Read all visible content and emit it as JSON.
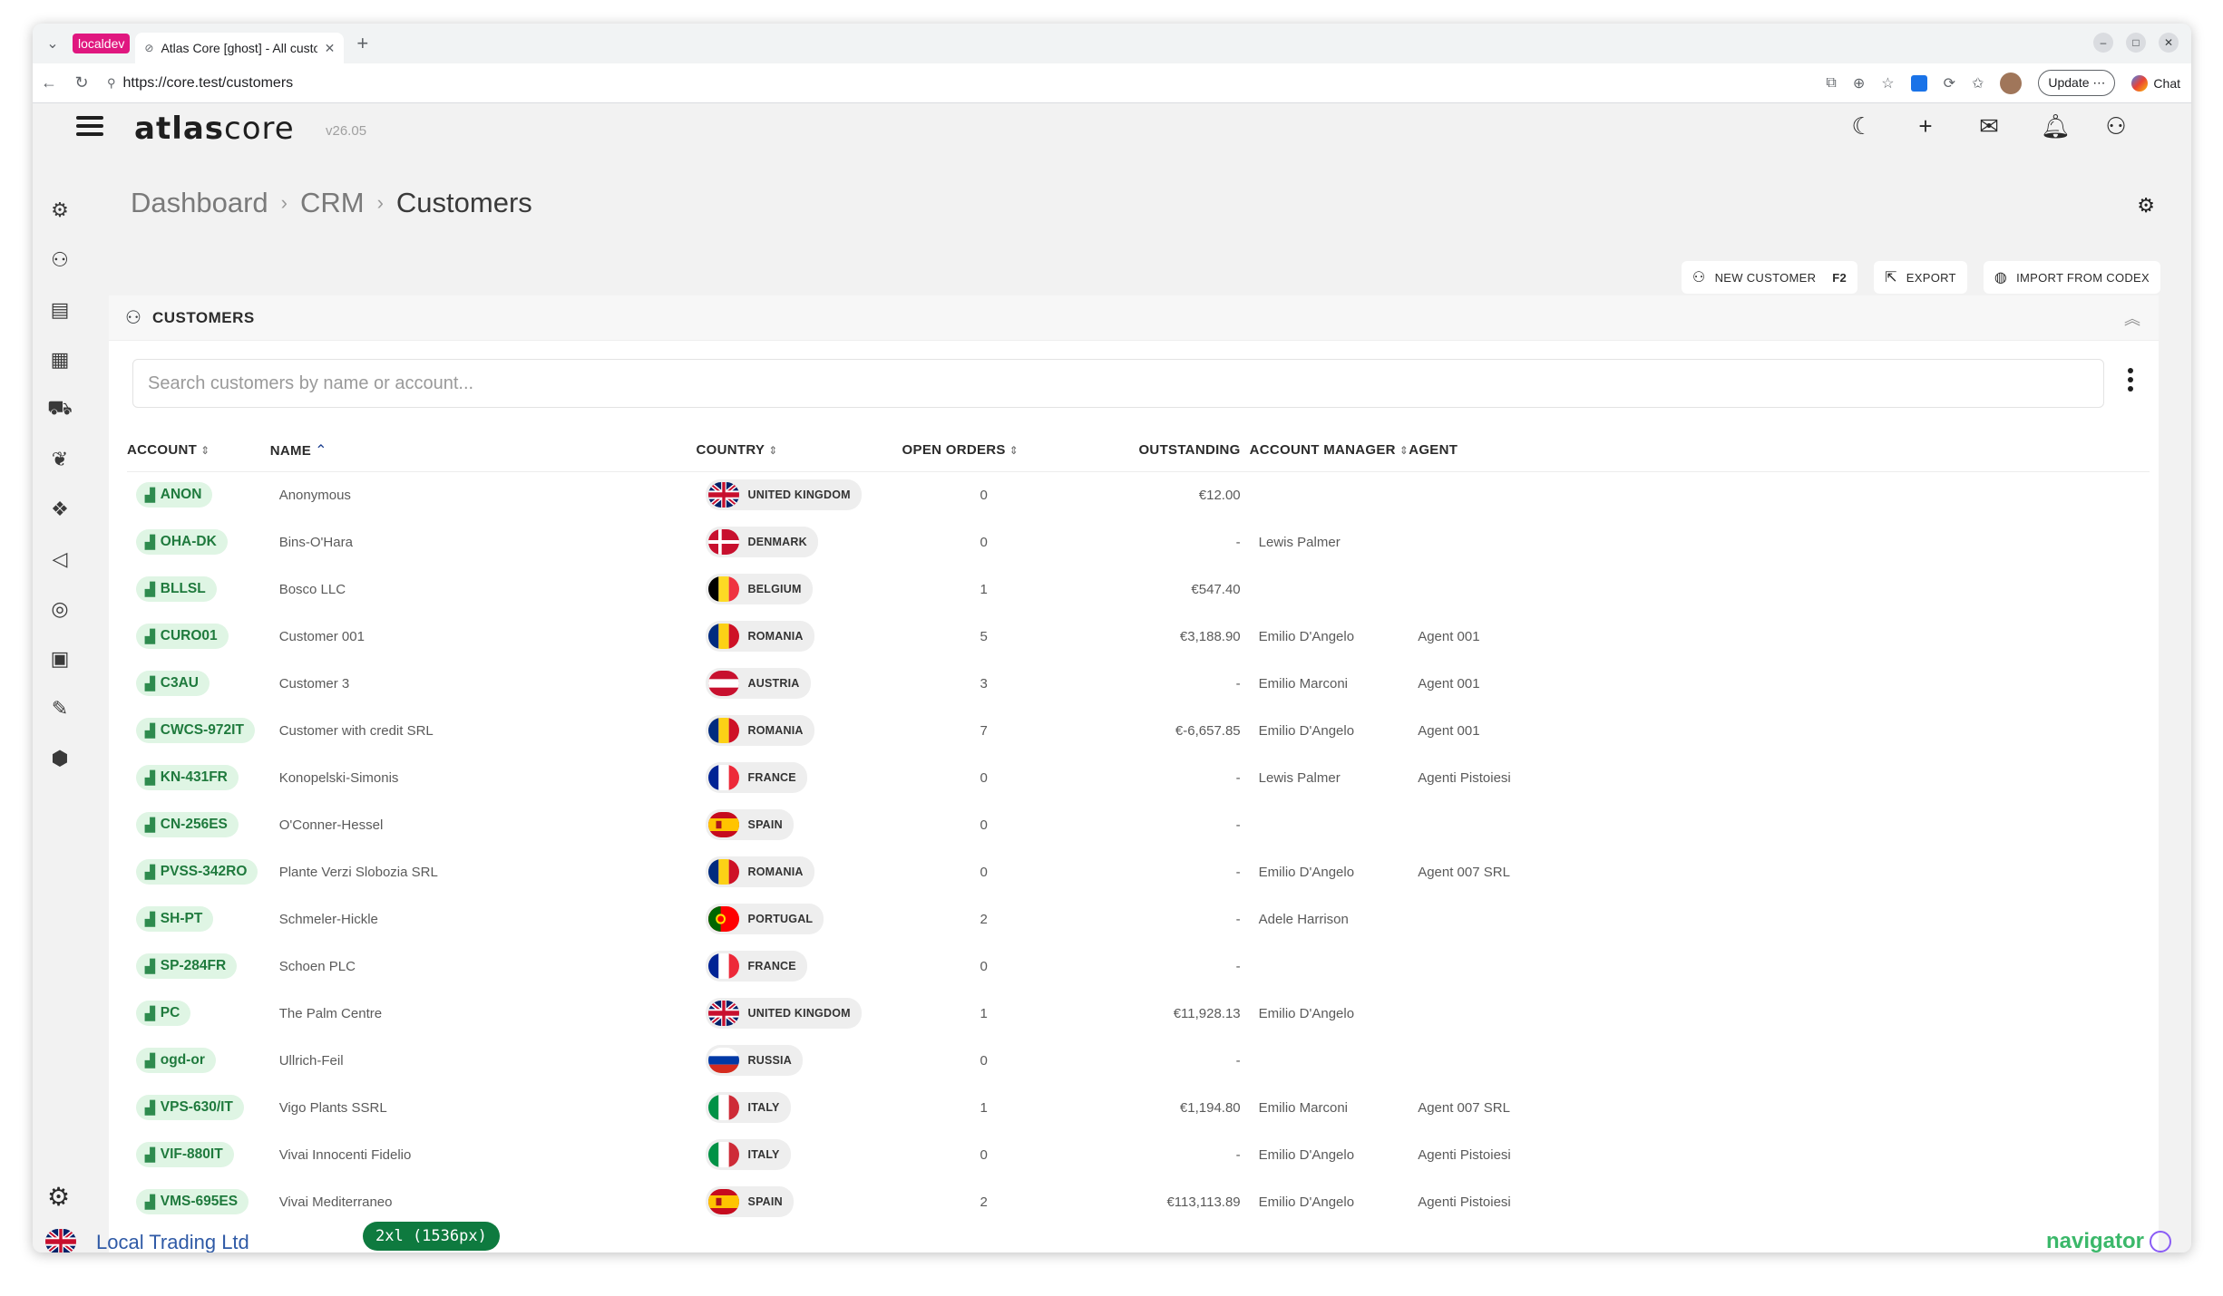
{
  "browser": {
    "profile_badge": "localdev",
    "tab_title": "Atlas Core [ghost] - All customers",
    "url": "https://core.test/customers",
    "update_label": "Update",
    "chat_label": "Chat"
  },
  "app": {
    "logo_bold": "atlas",
    "logo_light": "core",
    "version": "v26.05"
  },
  "breadcrumb": [
    "Dashboard",
    "CRM",
    "Customers"
  ],
  "actions": {
    "new_customer": "NEW CUSTOMER",
    "new_customer_key": "F2",
    "export": "EXPORT",
    "import": "IMPORT FROM CODEX"
  },
  "panel": {
    "title": "CUSTOMERS",
    "search_placeholder": "Search customers by name or account..."
  },
  "columns": [
    "ACCOUNT",
    "NAME",
    "COUNTRY",
    "OPEN ORDERS",
    "OUTSTANDING",
    "ACCOUNT MANAGER",
    "AGENT"
  ],
  "rows": [
    {
      "account": "ANON",
      "name": "Anonymous",
      "country": "UNITED KINGDOM",
      "flag": "uk",
      "orders": "0",
      "outstanding": "€12.00",
      "manager": "",
      "agent": ""
    },
    {
      "account": "OHA-DK",
      "name": "Bins-O'Hara",
      "country": "DENMARK",
      "flag": "dk",
      "orders": "0",
      "outstanding": "-",
      "manager": "Lewis Palmer",
      "agent": ""
    },
    {
      "account": "BLLSL",
      "name": "Bosco LLC",
      "country": "BELGIUM",
      "flag": "be",
      "orders": "1",
      "outstanding": "€547.40",
      "manager": "",
      "agent": ""
    },
    {
      "account": "CURO01",
      "name": "Customer 001",
      "country": "ROMANIA",
      "flag": "ro",
      "orders": "5",
      "outstanding": "€3,188.90",
      "manager": "Emilio D'Angelo",
      "agent": "Agent 001"
    },
    {
      "account": "C3AU",
      "name": "Customer 3",
      "country": "AUSTRIA",
      "flag": "at",
      "orders": "3",
      "outstanding": "-",
      "manager": "Emilio Marconi",
      "agent": "Agent 001"
    },
    {
      "account": "CWCS-972IT",
      "name": "Customer with credit SRL",
      "country": "ROMANIA",
      "flag": "ro",
      "orders": "7",
      "outstanding": "€-6,657.85",
      "manager": "Emilio D'Angelo",
      "agent": "Agent 001"
    },
    {
      "account": "KN-431FR",
      "name": "Konopelski-Simonis",
      "country": "FRANCE",
      "flag": "fr",
      "orders": "0",
      "outstanding": "-",
      "manager": "Lewis Palmer",
      "agent": "Agenti Pistoiesi"
    },
    {
      "account": "CN-256ES",
      "name": "O'Conner-Hessel",
      "country": "SPAIN",
      "flag": "es",
      "orders": "0",
      "outstanding": "-",
      "manager": "",
      "agent": ""
    },
    {
      "account": "PVSS-342RO",
      "name": "Plante Verzi Slobozia SRL",
      "country": "ROMANIA",
      "flag": "ro",
      "orders": "0",
      "outstanding": "-",
      "manager": "Emilio D'Angelo",
      "agent": "Agent 007 SRL"
    },
    {
      "account": "SH-PT",
      "name": "Schmeler-Hickle",
      "country": "PORTUGAL",
      "flag": "pt",
      "orders": "2",
      "outstanding": "-",
      "manager": "Adele Harrison",
      "agent": ""
    },
    {
      "account": "SP-284FR",
      "name": "Schoen PLC",
      "country": "FRANCE",
      "flag": "fr",
      "orders": "0",
      "outstanding": "-",
      "manager": "",
      "agent": ""
    },
    {
      "account": "PC",
      "name": "The Palm Centre",
      "country": "UNITED KINGDOM",
      "flag": "uk",
      "orders": "1",
      "outstanding": "€11,928.13",
      "manager": "Emilio D'Angelo",
      "agent": ""
    },
    {
      "account": "ogd-or",
      "name": "Ullrich-Feil",
      "country": "RUSSIA",
      "flag": "ru",
      "orders": "0",
      "outstanding": "-",
      "manager": "",
      "agent": ""
    },
    {
      "account": "VPS-630/IT",
      "name": "Vigo Plants SSRL",
      "country": "ITALY",
      "flag": "it",
      "orders": "1",
      "outstanding": "€1,194.80",
      "manager": "Emilio Marconi",
      "agent": "Agent 007 SRL"
    },
    {
      "account": "VIF-880IT",
      "name": "Vivai Innocenti Fidelio",
      "country": "ITALY",
      "flag": "it",
      "orders": "0",
      "outstanding": "-",
      "manager": "Emilio D'Angelo",
      "agent": "Agenti Pistoiesi"
    },
    {
      "account": "VMS-695ES",
      "name": "Vivai Mediterraneo",
      "country": "SPAIN",
      "flag": "es",
      "orders": "2",
      "outstanding": "€113,113.89",
      "manager": "Emilio D'Angelo",
      "agent": "Agenti Pistoiesi"
    }
  ],
  "footer": {
    "company": "Local Trading Ltd",
    "breakpoint": "2xl (1536px)",
    "brand": "navigator"
  },
  "colors": {
    "account_badge_bg": "#dff5e4",
    "account_badge_text": "#1f7a3d",
    "breakpoint_badge": "#0e7a3f",
    "brand": "#3bb86a",
    "company_link": "#2f5aa6"
  }
}
